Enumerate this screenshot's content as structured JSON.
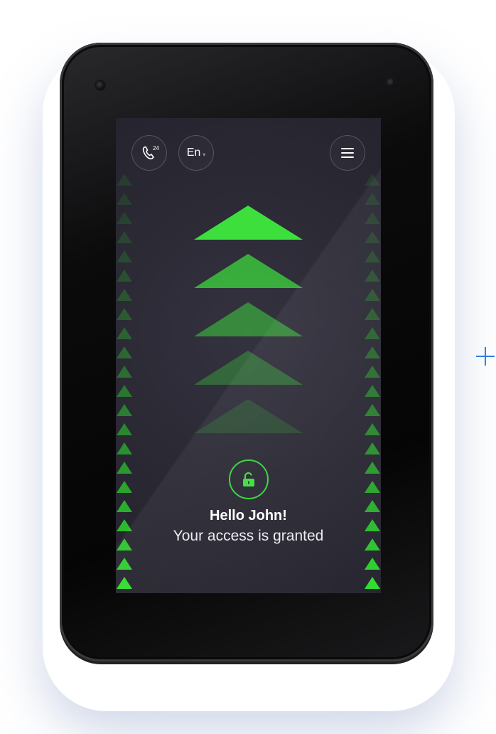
{
  "header": {
    "support_label": "24",
    "language_label": "En",
    "language_caret": "▾"
  },
  "message": {
    "greeting": "Hello John!",
    "status": "Your access is granted"
  },
  "icons": {
    "support": "phone-24-icon",
    "language_caret": "chevron-down-icon",
    "menu": "hamburger-menu-icon",
    "lock": "unlocked-padlock-icon",
    "arrows": "up-triangle-icon",
    "add": "plus-icon"
  },
  "colors": {
    "accent_green": "#3ddf3d",
    "screen_bg": "#2b2a35",
    "plus": "#2f7fe6"
  }
}
